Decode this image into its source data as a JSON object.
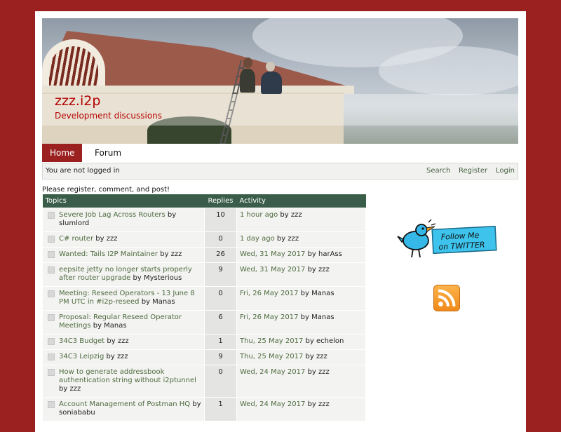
{
  "site": {
    "title": "zzz.i2p",
    "subtitle": "Development discussions"
  },
  "nav": {
    "items": [
      {
        "label": "Home",
        "active": true
      },
      {
        "label": "Forum",
        "active": false
      }
    ]
  },
  "userbar": {
    "status": "You are not logged in",
    "links": [
      "Search",
      "Register",
      "Login"
    ]
  },
  "intro": "Please register, comment, and post!",
  "table": {
    "headers": {
      "topics": "Topics",
      "replies": "Replies",
      "activity": "Activity"
    },
    "rows": [
      {
        "title": "Severe Job Lag Across Routers",
        "author": "slumlord",
        "replies": "10",
        "when": "1 hour ago",
        "by": "zzz"
      },
      {
        "title": "C# router",
        "author": "zzz",
        "replies": "0",
        "when": "1 day ago",
        "by": "zzz"
      },
      {
        "title": "Wanted: Tails I2P Maintainer",
        "author": "zzz",
        "replies": "26",
        "when": "Wed, 31 May 2017",
        "by": "harAss"
      },
      {
        "title": "eepsite jetty no longer starts properly after router upgrade",
        "author": "Mysterious",
        "replies": "9",
        "when": "Wed, 31 May 2017",
        "by": "zzz"
      },
      {
        "title": "Meeting: Reseed Operators - 13 June 8 PM UTC in #i2p-reseed",
        "author": "Manas",
        "replies": "0",
        "when": "Fri, 26 May 2017",
        "by": "Manas"
      },
      {
        "title": "Proposal: Regular Reseed Operator Meetings",
        "author": "Manas",
        "replies": "6",
        "when": "Fri, 26 May 2017",
        "by": "Manas"
      },
      {
        "title": "34C3 Budget",
        "author": "zzz",
        "replies": "1",
        "when": "Thu, 25 May 2017",
        "by": "echelon"
      },
      {
        "title": "34C3 Leipzig",
        "author": "zzz",
        "replies": "9",
        "when": "Thu, 25 May 2017",
        "by": "zzz"
      },
      {
        "title": "How to generate addressbook authentication string without i2ptunnel",
        "author": "zzz",
        "replies": "0",
        "when": "Wed, 24 May 2017",
        "by": "zzz"
      },
      {
        "title": "Account Management of Postman HQ",
        "author": "soniababu",
        "replies": "1",
        "when": "Wed, 24 May 2017",
        "by": "zzz"
      }
    ]
  },
  "sidebar": {
    "twitter_line1": "Follow Me",
    "twitter_line2": "on TWITTER"
  },
  "colors": {
    "background": "#9b2020",
    "header_green": "#395d48",
    "link_green": "#4e6b3f",
    "title_red": "#b40000"
  }
}
